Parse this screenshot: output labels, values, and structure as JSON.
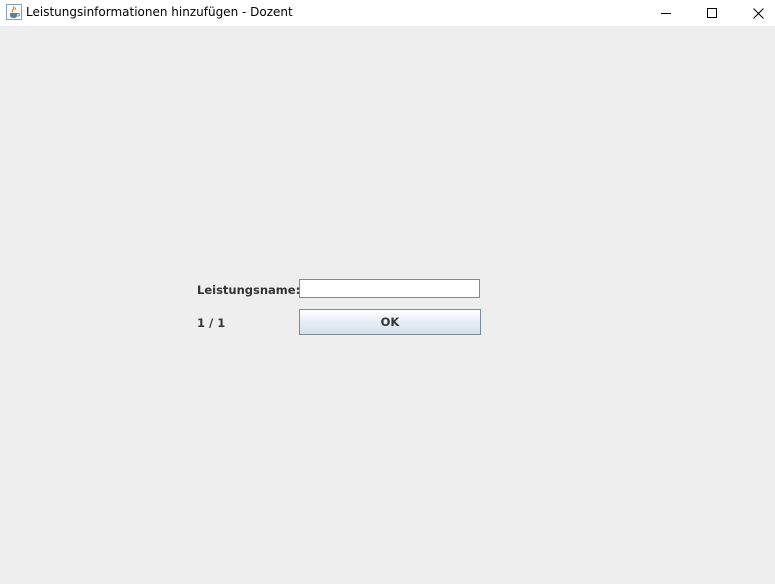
{
  "window": {
    "title": "Leistungsinformationen hinzufügen - Dozent",
    "icon": "java-cup-icon",
    "controls": {
      "minimize_icon": "minimize-icon",
      "maximize_icon": "maximize-icon",
      "close_icon": "close-icon"
    }
  },
  "form": {
    "name_label": "Leistungsname:",
    "name_value": "",
    "counter": "1 / 1",
    "ok_label": "OK"
  }
}
